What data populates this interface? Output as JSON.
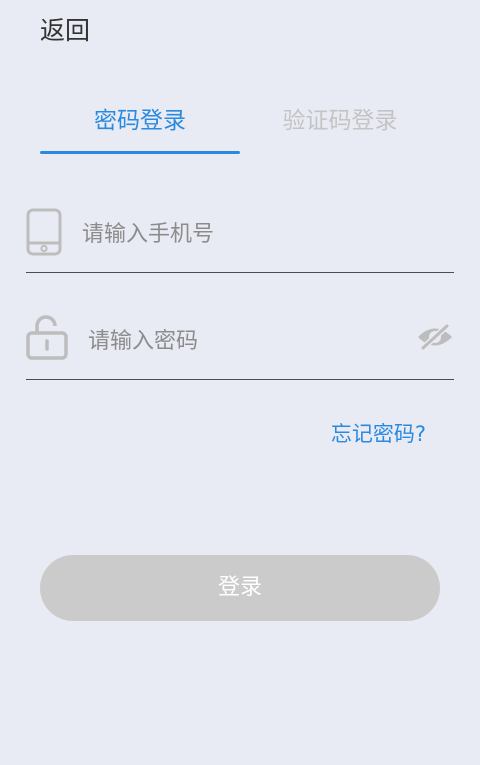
{
  "header": {
    "back_label": "返回"
  },
  "tabs": [
    {
      "label": "密码登录",
      "active": true
    },
    {
      "label": "验证码登录",
      "active": false
    }
  ],
  "form": {
    "phone": {
      "placeholder": "请输入手机号",
      "value": "",
      "icon": "phone-icon"
    },
    "password": {
      "placeholder": "请输入密码",
      "value": "",
      "icon": "lock-icon",
      "toggle_icon": "eye-slash-icon"
    },
    "forgot_label": "忘记密码?",
    "login_label": "登录"
  },
  "colors": {
    "background": "#e8ebf3",
    "accent": "#2a8ae0",
    "inactive_tab": "#c4c4c4",
    "button_disabled": "#cbcbcb",
    "icon_gray": "#bdbdbd"
  }
}
